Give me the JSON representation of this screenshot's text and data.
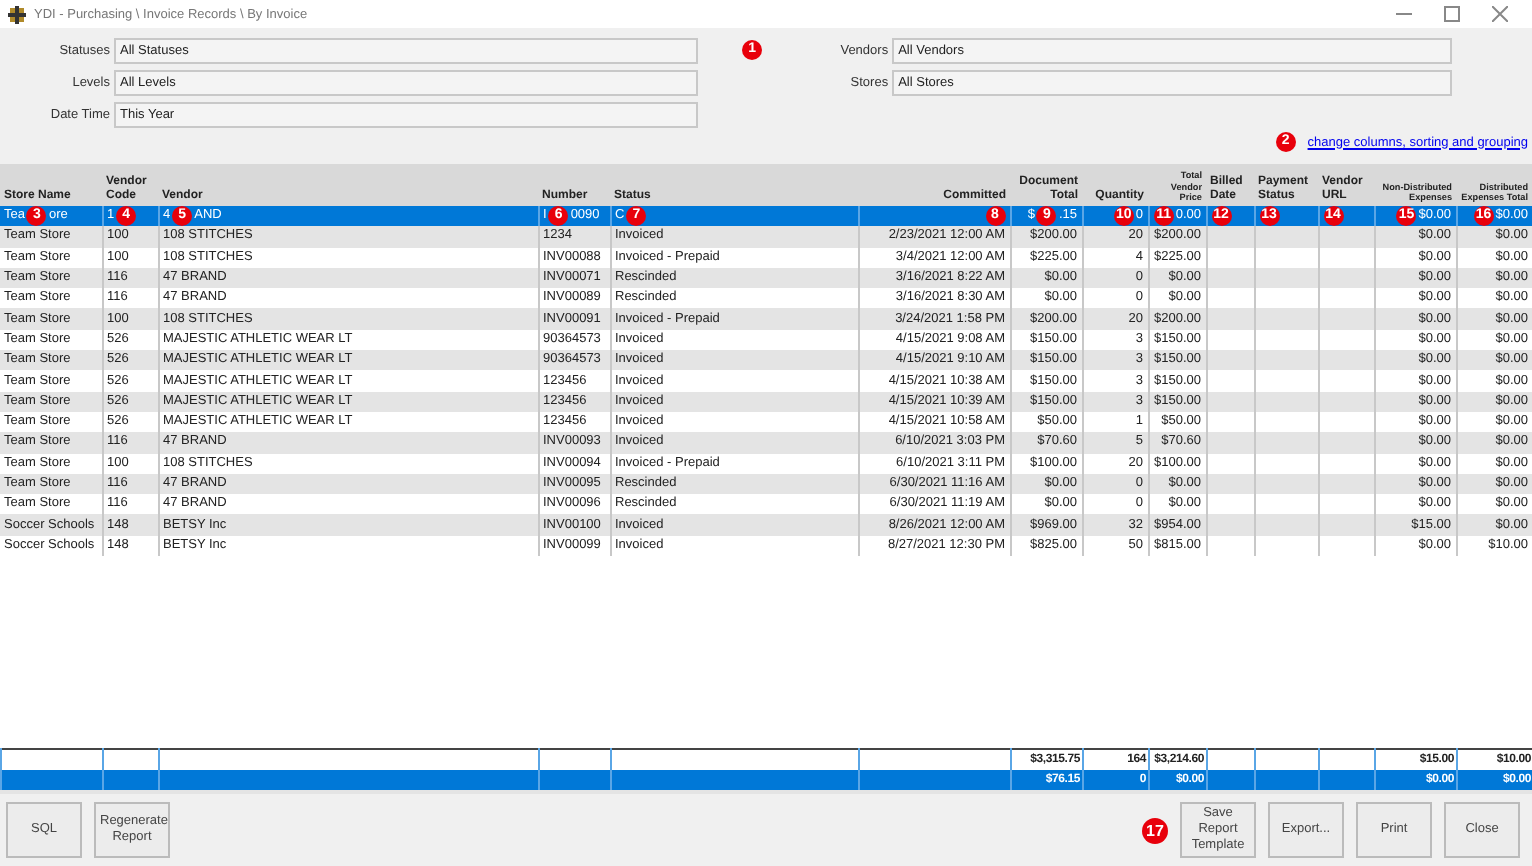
{
  "window": {
    "title": "YDI - Purchasing \\ Invoice Records \\ By Invoice"
  },
  "filters_left": [
    {
      "label": "Statuses",
      "value": "All Statuses"
    },
    {
      "label": "Levels",
      "value": "All Levels"
    },
    {
      "label": "Date Time",
      "value": "This Year"
    }
  ],
  "filter_marker": "1",
  "filters_right": [
    {
      "label": "Vendors",
      "value": "All Vendors"
    },
    {
      "label": "Stores",
      "value": "All Stores"
    }
  ],
  "link": {
    "marker": "2",
    "text": "change columns, sorting and grouping"
  },
  "table": {
    "columns": [
      "Store Name",
      "Vendor Code",
      "Vendor",
      "Number",
      "Status",
      "Committed",
      "Document Total",
      "Quantity",
      "Total Vendor Price",
      "Billed Date",
      "Payment Status",
      "Vendor URL",
      "Non-Distributed Expenses",
      "Distributed Expenses Total"
    ],
    "rows": [
      {
        "selected": true,
        "cells": [
          {
            "before": "Tea",
            "marker": "3",
            "after": "ore"
          },
          {
            "before": "1",
            "marker": "4"
          },
          {
            "before": "4",
            "marker": "5",
            "after": "AND"
          },
          {
            "before": "I",
            "marker": "6",
            "after": "0090"
          },
          {
            "before": "C",
            "marker": "7"
          },
          {
            "marker": "8"
          },
          {
            "before": "$",
            "marker": "9",
            "after": ".15"
          },
          {
            "marker": "10",
            "after": "0"
          },
          {
            "marker": "11",
            "after": "0.00"
          },
          {
            "marker": "12"
          },
          {
            "marker": "13"
          },
          {
            "marker": "14"
          },
          {
            "marker": "15",
            "after": "$0.00"
          },
          {
            "marker": "16",
            "after": "$0.00"
          }
        ]
      },
      {
        "selected": false,
        "cells": [
          "Team Store",
          "100",
          "108 STITCHES",
          "1234",
          "Invoiced",
          "2/23/2021 12:00 AM",
          "$200.00",
          "20",
          "$200.00",
          null,
          null,
          null,
          "$0.00",
          "$0.00"
        ]
      },
      {
        "selected": false,
        "cells": [
          "Team Store",
          "100",
          "108 STITCHES",
          "INV00088",
          "Invoiced - Prepaid",
          "3/4/2021 12:00 AM",
          "$225.00",
          "4",
          "$225.00",
          null,
          null,
          null,
          "$0.00",
          "$0.00"
        ]
      },
      {
        "selected": false,
        "cells": [
          "Team Store",
          "116",
          "47 BRAND",
          "INV00071",
          "Rescinded",
          "3/16/2021 8:22 AM",
          "$0.00",
          "0",
          "$0.00",
          null,
          null,
          null,
          "$0.00",
          "$0.00"
        ]
      },
      {
        "selected": false,
        "cells": [
          "Team Store",
          "116",
          "47 BRAND",
          "INV00089",
          "Rescinded",
          "3/16/2021 8:30 AM",
          "$0.00",
          "0",
          "$0.00",
          null,
          null,
          null,
          "$0.00",
          "$0.00"
        ]
      },
      {
        "selected": false,
        "cells": [
          "Team Store",
          "100",
          "108 STITCHES",
          "INV00091",
          "Invoiced - Prepaid",
          "3/24/2021 1:58 PM",
          "$200.00",
          "20",
          "$200.00",
          null,
          null,
          null,
          "$0.00",
          "$0.00"
        ]
      },
      {
        "selected": false,
        "cells": [
          "Team Store",
          "526",
          "MAJESTIC ATHLETIC WEAR LT",
          "90364573",
          "Invoiced",
          "4/15/2021 9:08 AM",
          "$150.00",
          "3",
          "$150.00",
          null,
          null,
          null,
          "$0.00",
          "$0.00"
        ]
      },
      {
        "selected": false,
        "cells": [
          "Team Store",
          "526",
          "MAJESTIC ATHLETIC WEAR LT",
          "90364573",
          "Invoiced",
          "4/15/2021 9:10 AM",
          "$150.00",
          "3",
          "$150.00",
          null,
          null,
          null,
          "$0.00",
          "$0.00"
        ]
      },
      {
        "selected": false,
        "cells": [
          "Team Store",
          "526",
          "MAJESTIC ATHLETIC WEAR LT",
          "123456",
          "Invoiced",
          "4/15/2021 10:38 AM",
          "$150.00",
          "3",
          "$150.00",
          null,
          null,
          null,
          "$0.00",
          "$0.00"
        ]
      },
      {
        "selected": false,
        "cells": [
          "Team Store",
          "526",
          "MAJESTIC ATHLETIC WEAR LT",
          "123456",
          "Invoiced",
          "4/15/2021 10:39 AM",
          "$150.00",
          "3",
          "$150.00",
          null,
          null,
          null,
          "$0.00",
          "$0.00"
        ]
      },
      {
        "selected": false,
        "cells": [
          "Team Store",
          "526",
          "MAJESTIC ATHLETIC WEAR LT",
          "123456",
          "Invoiced",
          "4/15/2021 10:58 AM",
          "$50.00",
          "1",
          "$50.00",
          null,
          null,
          null,
          "$0.00",
          "$0.00"
        ]
      },
      {
        "selected": false,
        "cells": [
          "Team Store",
          "116",
          "47 BRAND",
          "INV00093",
          "Invoiced",
          "6/10/2021 3:03 PM",
          "$70.60",
          "5",
          "$70.60",
          null,
          null,
          null,
          "$0.00",
          "$0.00"
        ]
      },
      {
        "selected": false,
        "cells": [
          "Team Store",
          "100",
          "108 STITCHES",
          "INV00094",
          "Invoiced - Prepaid",
          "6/10/2021 3:11 PM",
          "$100.00",
          "20",
          "$100.00",
          null,
          null,
          null,
          "$0.00",
          "$0.00"
        ]
      },
      {
        "selected": false,
        "cells": [
          "Team Store",
          "116",
          "47 BRAND",
          "INV00095",
          "Rescinded",
          "6/30/2021 11:16 AM",
          "$0.00",
          "0",
          "$0.00",
          null,
          null,
          null,
          "$0.00",
          "$0.00"
        ]
      },
      {
        "selected": false,
        "cells": [
          "Team Store",
          "116",
          "47 BRAND",
          "INV00096",
          "Rescinded",
          "6/30/2021 11:19 AM",
          "$0.00",
          "0",
          "$0.00",
          null,
          null,
          null,
          "$0.00",
          "$0.00"
        ]
      },
      {
        "selected": false,
        "cells": [
          "Soccer Schools",
          "148",
          "BETSY Inc",
          "INV00100",
          "Invoiced",
          "8/26/2021 12:00 AM",
          "$969.00",
          "32",
          "$954.00",
          null,
          null,
          null,
          "$15.00",
          "$0.00"
        ]
      },
      {
        "selected": false,
        "cells": [
          "Soccer Schools",
          "148",
          "BETSY Inc",
          "INV00099",
          "Invoiced",
          "8/27/2021 12:30 PM",
          "$825.00",
          "50",
          "$815.00",
          null,
          null,
          null,
          "$0.00",
          "$10.00"
        ]
      }
    ],
    "totals": [
      {
        "document_total": "$3,315.75",
        "quantity": "164",
        "total_vendor_price": "$3,214.60",
        "non_distributed_expenses": "$15.00",
        "distributed_expenses_total": "$10.00"
      },
      {
        "document_total": "$76.15",
        "quantity": "0",
        "total_vendor_price": "$0.00",
        "non_distributed_expenses": "$0.00",
        "distributed_expenses_total": "$0.00"
      }
    ]
  },
  "buttons_left": [
    {
      "label": "SQL"
    },
    {
      "label": "Regenerate Report"
    }
  ],
  "buttons_right": [
    {
      "label": "Save Report Template",
      "marker": "17"
    },
    {
      "label": "Export..."
    },
    {
      "label": "Print"
    },
    {
      "label": "Close"
    }
  ]
}
